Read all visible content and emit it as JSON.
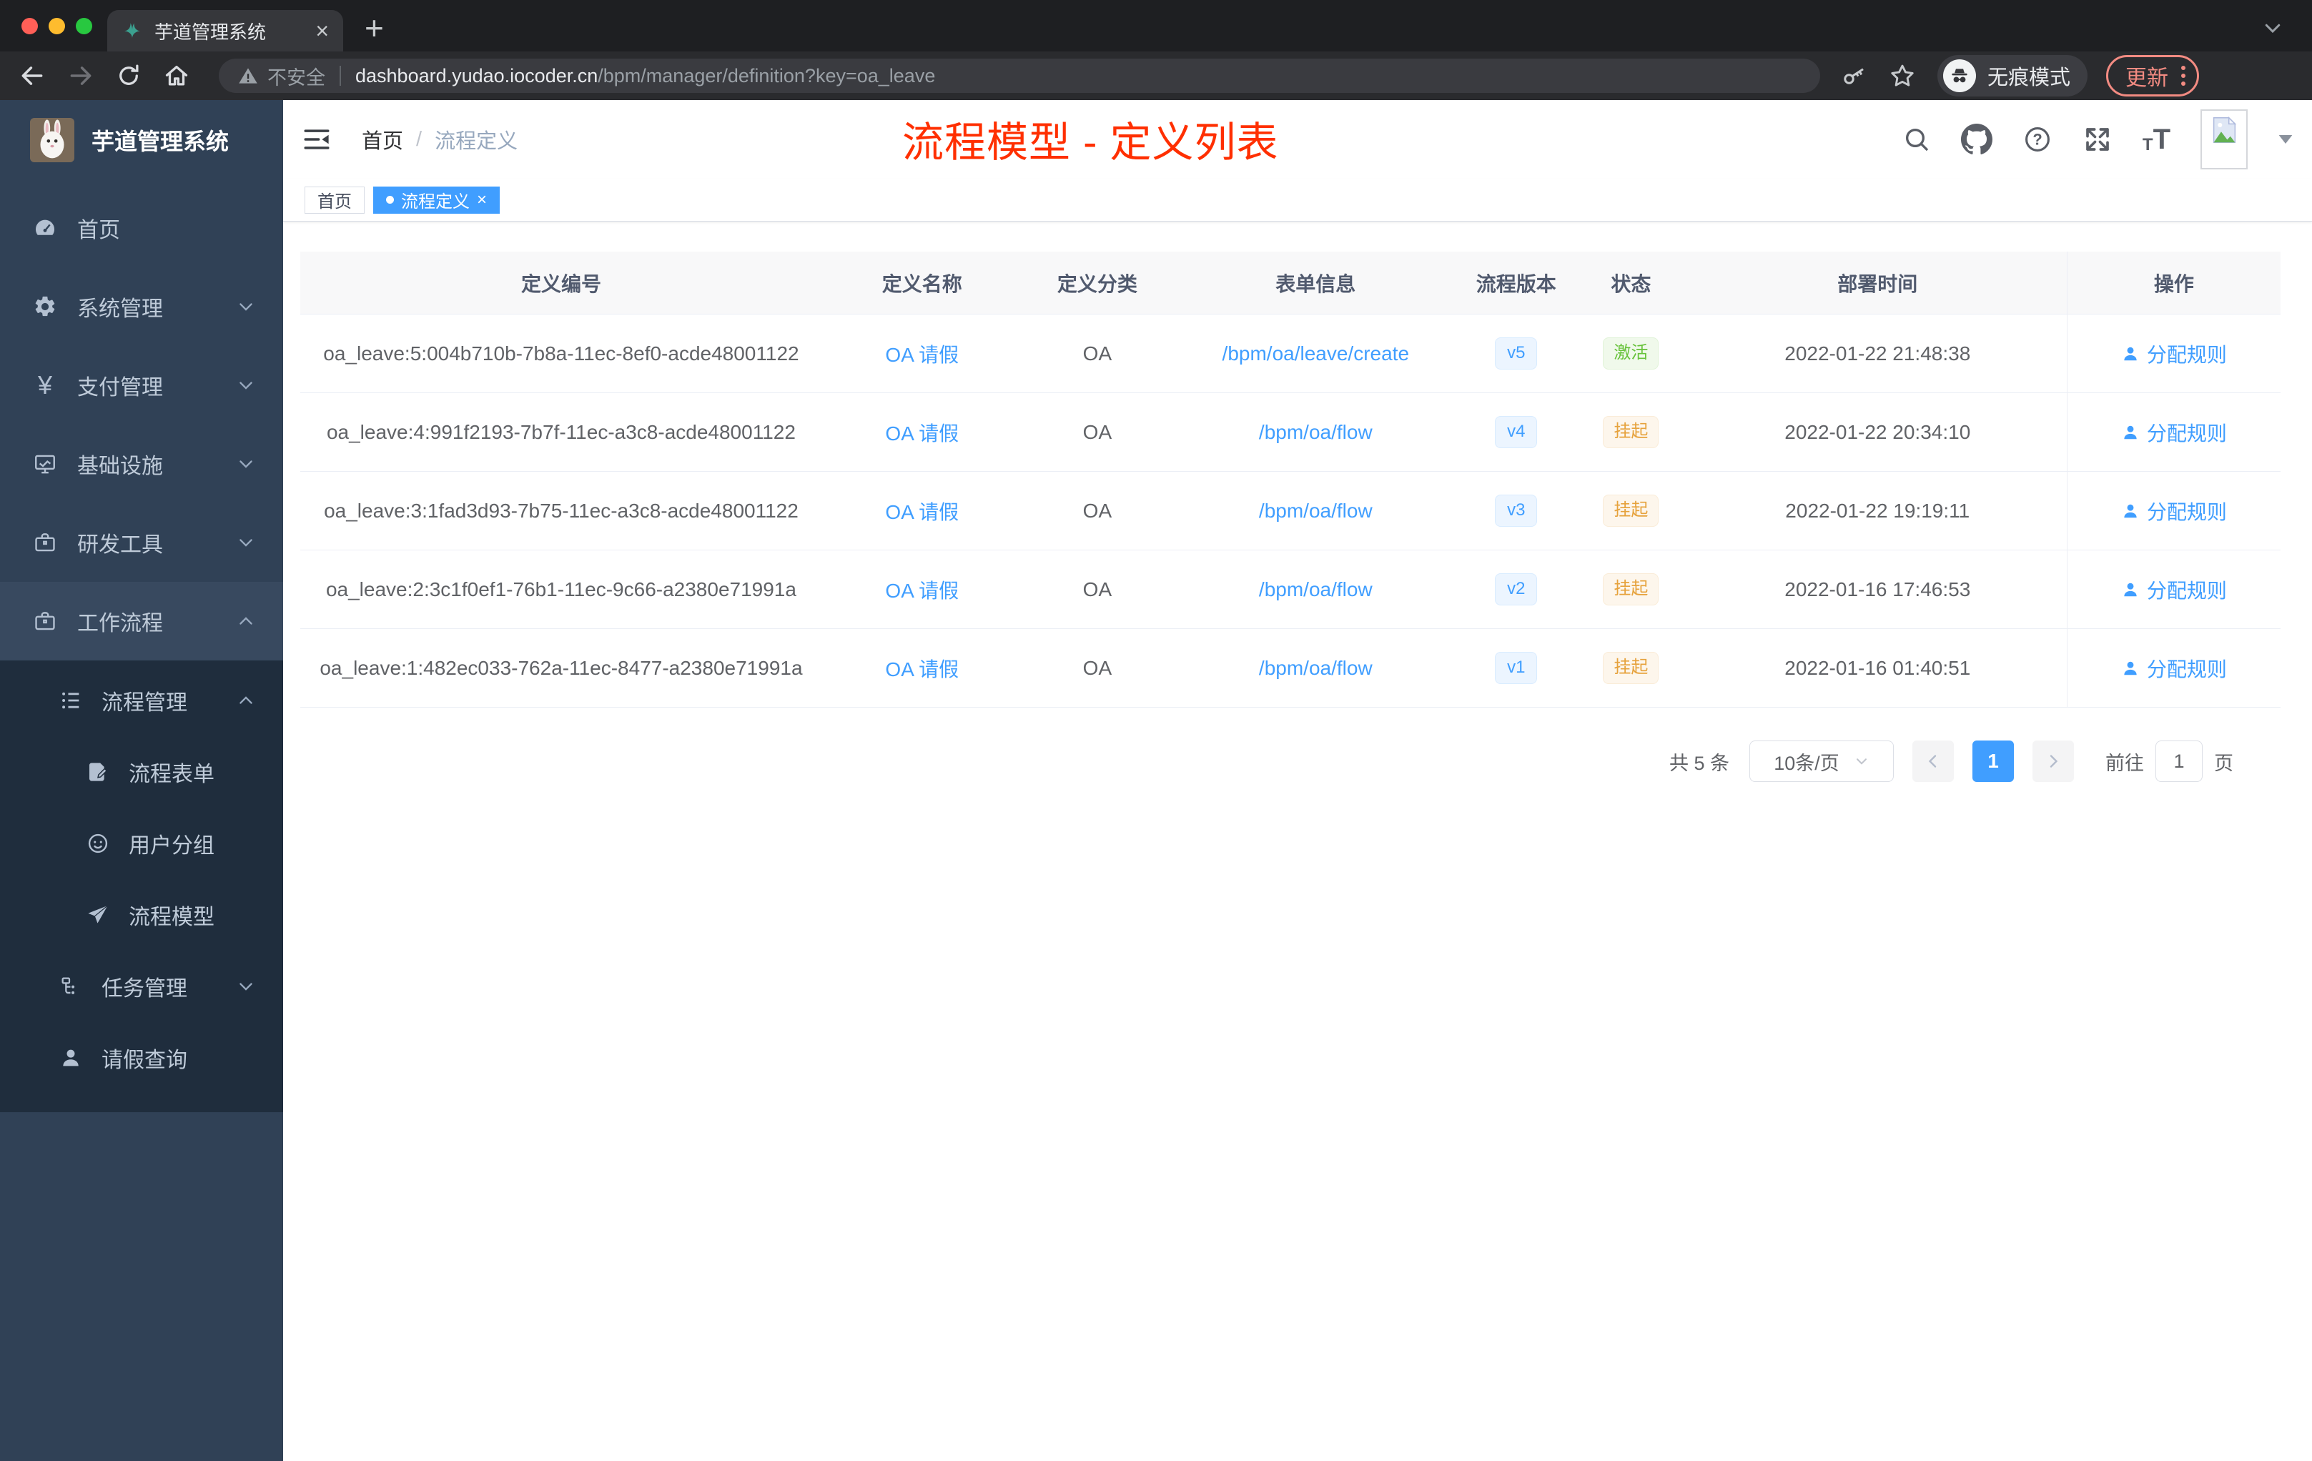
{
  "colors": {
    "accent": "#409eff",
    "annotation_red": "#ff2f00",
    "success": "#67c23a",
    "warning": "#e6a23c",
    "sidebar_bg": "#304156",
    "submenu_bg": "#1f2d3d"
  },
  "browser": {
    "tab_title": "芋道管理系统",
    "security_label": "不安全",
    "url_host": "dashboard.yudao.iocoder.cn",
    "url_path": "/bpm/manager/definition?key=oa_leave",
    "incognito_label": "无痕模式",
    "update_label": "更新"
  },
  "sidebar": {
    "logo_title": "芋道管理系统",
    "menu": [
      {
        "label": "首页"
      },
      {
        "label": "系统管理"
      },
      {
        "label": "支付管理"
      },
      {
        "label": "基础设施"
      },
      {
        "label": "研发工具"
      },
      {
        "label": "工作流程"
      }
    ],
    "submenu": [
      {
        "label": "流程管理"
      },
      {
        "label": "流程表单"
      },
      {
        "label": "用户分组"
      },
      {
        "label": "流程模型"
      },
      {
        "label": "任务管理"
      },
      {
        "label": "请假查询"
      }
    ]
  },
  "header": {
    "breadcrumb_home": "首页",
    "breadcrumb_separator": "/",
    "breadcrumb_current": "流程定义"
  },
  "annotation": {
    "text": "流程模型 - 定义列表",
    "color": "#ff2f00"
  },
  "tags": {
    "home": "首页",
    "active": "流程定义"
  },
  "table": {
    "columns": [
      "定义编号",
      "定义名称",
      "定义分类",
      "表单信息",
      "流程版本",
      "状态",
      "部署时间",
      "操作"
    ],
    "action_label": "分配规则",
    "rows": [
      {
        "id": "oa_leave:5:004b710b-7b8a-11ec-8ef0-acde48001122",
        "name": "OA 请假",
        "category": "OA",
        "form": "/bpm/oa/leave/create",
        "version": "v5",
        "status": "激活",
        "status_type": "success",
        "deployed_at": "2022-01-22 21:48:38"
      },
      {
        "id": "oa_leave:4:991f2193-7b7f-11ec-a3c8-acde48001122",
        "name": "OA 请假",
        "category": "OA",
        "form": "/bpm/oa/flow",
        "version": "v4",
        "status": "挂起",
        "status_type": "warning",
        "deployed_at": "2022-01-22 20:34:10"
      },
      {
        "id": "oa_leave:3:1fad3d93-7b75-11ec-a3c8-acde48001122",
        "name": "OA 请假",
        "category": "OA",
        "form": "/bpm/oa/flow",
        "version": "v3",
        "status": "挂起",
        "status_type": "warning",
        "deployed_at": "2022-01-22 19:19:11"
      },
      {
        "id": "oa_leave:2:3c1f0ef1-76b1-11ec-9c66-a2380e71991a",
        "name": "OA 请假",
        "category": "OA",
        "form": "/bpm/oa/flow",
        "version": "v2",
        "status": "挂起",
        "status_type": "warning",
        "deployed_at": "2022-01-16 17:46:53"
      },
      {
        "id": "oa_leave:1:482ec033-762a-11ec-8477-a2380e71991a",
        "name": "OA 请假",
        "category": "OA",
        "form": "/bpm/oa/flow",
        "version": "v1",
        "status": "挂起",
        "status_type": "warning",
        "deployed_at": "2022-01-16 01:40:51"
      }
    ]
  },
  "pagination": {
    "total": "共 5 条",
    "page_size": "10条/页",
    "current_page": "1",
    "goto_label": "前往",
    "goto_value": "1",
    "page_unit": "页"
  }
}
